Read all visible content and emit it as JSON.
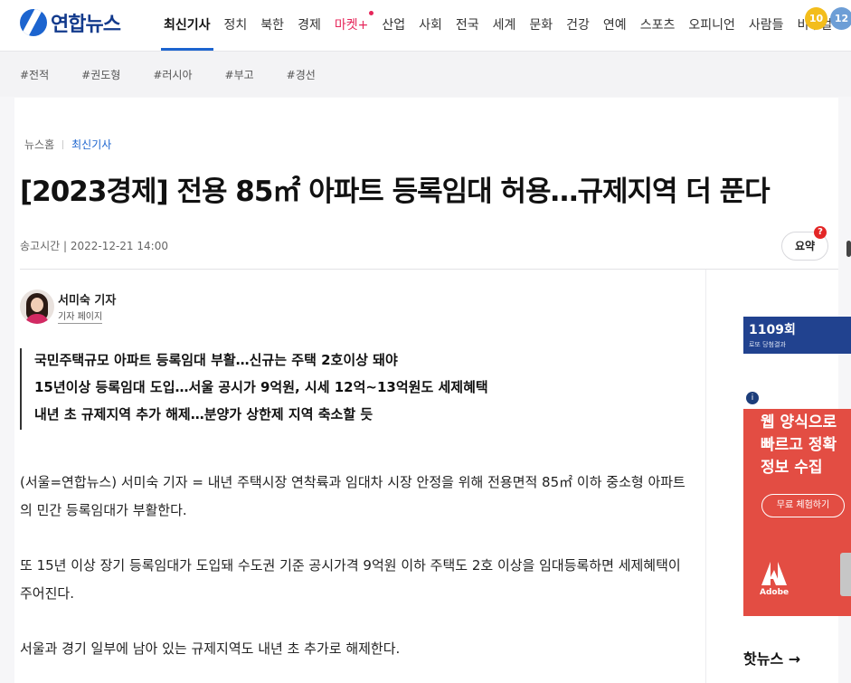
{
  "header": {
    "logo_text": "연합뉴스",
    "nav": [
      "최신기사",
      "정치",
      "북한",
      "경제",
      "마켓+",
      "산업",
      "사회",
      "전국",
      "세계",
      "문화",
      "건강",
      "연예",
      "스포츠",
      "오피니언",
      "사람들",
      "비주얼"
    ]
  },
  "tags": [
    "#전적",
    "#권도형",
    "#러시아",
    "#부고",
    "#경선"
  ],
  "breadcrumb": {
    "home": "뉴스홈",
    "current": "최신기사"
  },
  "article": {
    "title": "[2023경제] 전용 85㎡ 아파트 등록임대 허용…규제지역 더 푼다",
    "published": "송고시간 | 2022-12-21 14:00",
    "summary_label": "요약",
    "summary_badge": "?",
    "author_name": "서미숙 기자",
    "author_page": "기자 페이지",
    "lead": [
      "국민주택규모 아파트 등록임대 부활…신규는 주택 2호이상 돼야",
      "15년이상 등록임대 도입…서울 공시가 9억원, 시세 12억~13억원도 세제혜택",
      "내년 초 규제지역 추가 해제…분양가 상한제 지역 축소할 듯"
    ],
    "paragraphs": [
      "(서울=연합뉴스) 서미숙 기자 = 내년 주택시장 연착륙과 임대차 시장 안정을 위해 전용면적 85㎡ 이하 중소형 아파트의 민간 등록임대가 부활한다.",
      "또 15년 이상 장기 등록임대가 도입돼 수도권 기준 공시가격 9억원 이하 주택도 2호 이상을 임대등록하면 세제혜택이 주어진다.",
      "서울과 경기 일부에 남아 있는 규제지역도 내년 초 추가로 해제한다."
    ]
  },
  "sidebar": {
    "lotto_round": "1109회",
    "lotto_sub": "로또 당첨결과",
    "balls": [
      "10",
      "12"
    ],
    "ad_info": "i",
    "ad_lines": [
      "웹 양식으로",
      "빠르고 정확",
      "정보 수집"
    ],
    "ad_button": "무료 체험하기",
    "ad_brand": "Adobe",
    "hot_news": "핫뉴스 →"
  },
  "colors": {
    "accent": "#1c64cf",
    "market": "#e6265a",
    "ad_bg": "#e34d43",
    "lotto_bg": "#21428f"
  }
}
